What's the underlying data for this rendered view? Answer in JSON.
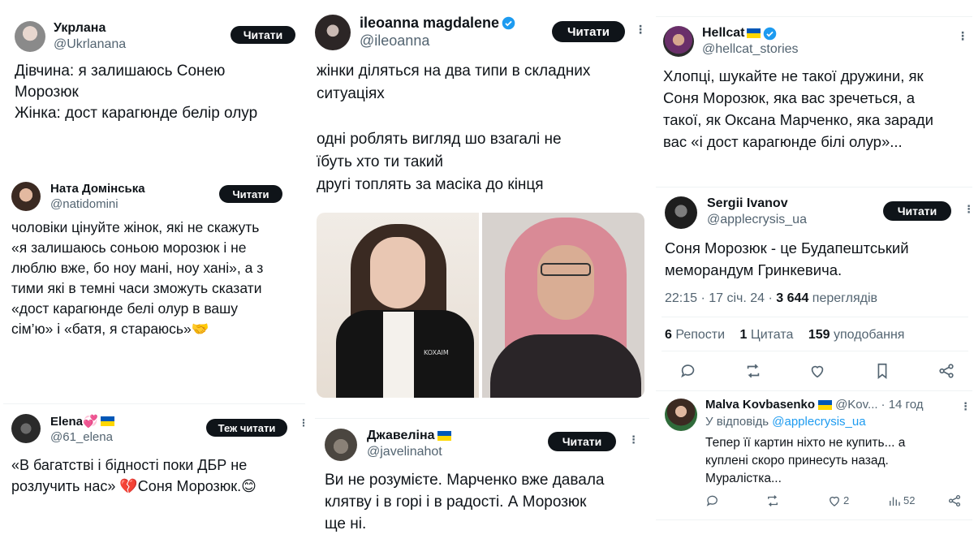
{
  "colors": {
    "accent": "#1d9bf0",
    "text": "#0f1419",
    "muted": "#536471",
    "divider": "#eff3f4"
  },
  "tweets": {
    "t1": {
      "name": "Укрлана",
      "handle": "@Ukrlanana",
      "follow": "Читати",
      "text": "Дівчина: я залишаюсь Сонею\nМорозюк\nЖінка: дост карагюнде белір олур"
    },
    "t2": {
      "name": "Ната Домінська",
      "handle": "@natidomini",
      "follow": "Читати",
      "text": "чоловіки цінуйте жінок, які не скажуть\n«я залишаюсь соньою морозюк і не\nлюблю вже, бо ноу мані, ноу хані», а з\nтими які в темні часи зможуть сказати\n«дост карагюнде белі олур в вашу\nсім’ю» і «батя, я стараюсь»🤝"
    },
    "t3": {
      "name": "Elena💞",
      "handle": "@61_elena",
      "follow": "Теж читати",
      "text": "«В багатстві і бідності поки ДБР не\nрозлучить нас» 💔Соня Морозюк.😊"
    },
    "t4": {
      "name": "ileoanna magdalene",
      "handle": "@ileoanna",
      "follow": "Читати",
      "text": "жінки діляться на два типи в складних\nситуаціях\n\nодні роблять вигляд шо взагалі не\nїбуть хто ти такий\nдругі топлять за масіка до кінця",
      "photo_badge": "KOXAIM"
    },
    "t5": {
      "name": "Джавеліна",
      "handle": "@javelinahot",
      "follow": "Читати",
      "text": "Ви не розумієте. Марченко вже давала\nклятву і в горі і в радості. А Морозюк\nще ні."
    },
    "t6": {
      "name": "Hellcat",
      "handle": "@hellcat_stories",
      "text": "Хлопці, шукайте не такої дружини, як\nСоня Морозюк, яка вас зречеться, а\nтакої, як Оксана Марченко, яка заради\nвас «і дост карагюнде білі олур»..."
    },
    "t7": {
      "name": "Sergii Ivanov",
      "handle": "@applecrysis_ua",
      "follow": "Читати",
      "text": "Соня Морозюк - це Будапештський\nмеморандум Гринкевича.",
      "time": "22:15 · 17 січ. 24 · ",
      "views_count": "3 644",
      "views_label": " переглядів",
      "reposts_count": "6",
      "reposts_label": " Репости",
      "quotes_count": "1",
      "quotes_label": " Цитата",
      "likes_count": "159",
      "likes_label": " уподобання",
      "actions": [
        "reply-icon",
        "repost-icon",
        "like-icon",
        "bookmark-icon",
        "share-icon"
      ]
    },
    "t8": {
      "name": "Malva Kovbasenko",
      "handle": "@Kov...",
      "age": "· 14 год",
      "reply_prefix": "У відповідь ",
      "reply_to": "@applecrysis_ua",
      "text": "Тепер її картин ніхто не купить... а\nкуплені скоро принесуть назад.\nМуралістка...",
      "likes": "2",
      "views": "52"
    }
  }
}
